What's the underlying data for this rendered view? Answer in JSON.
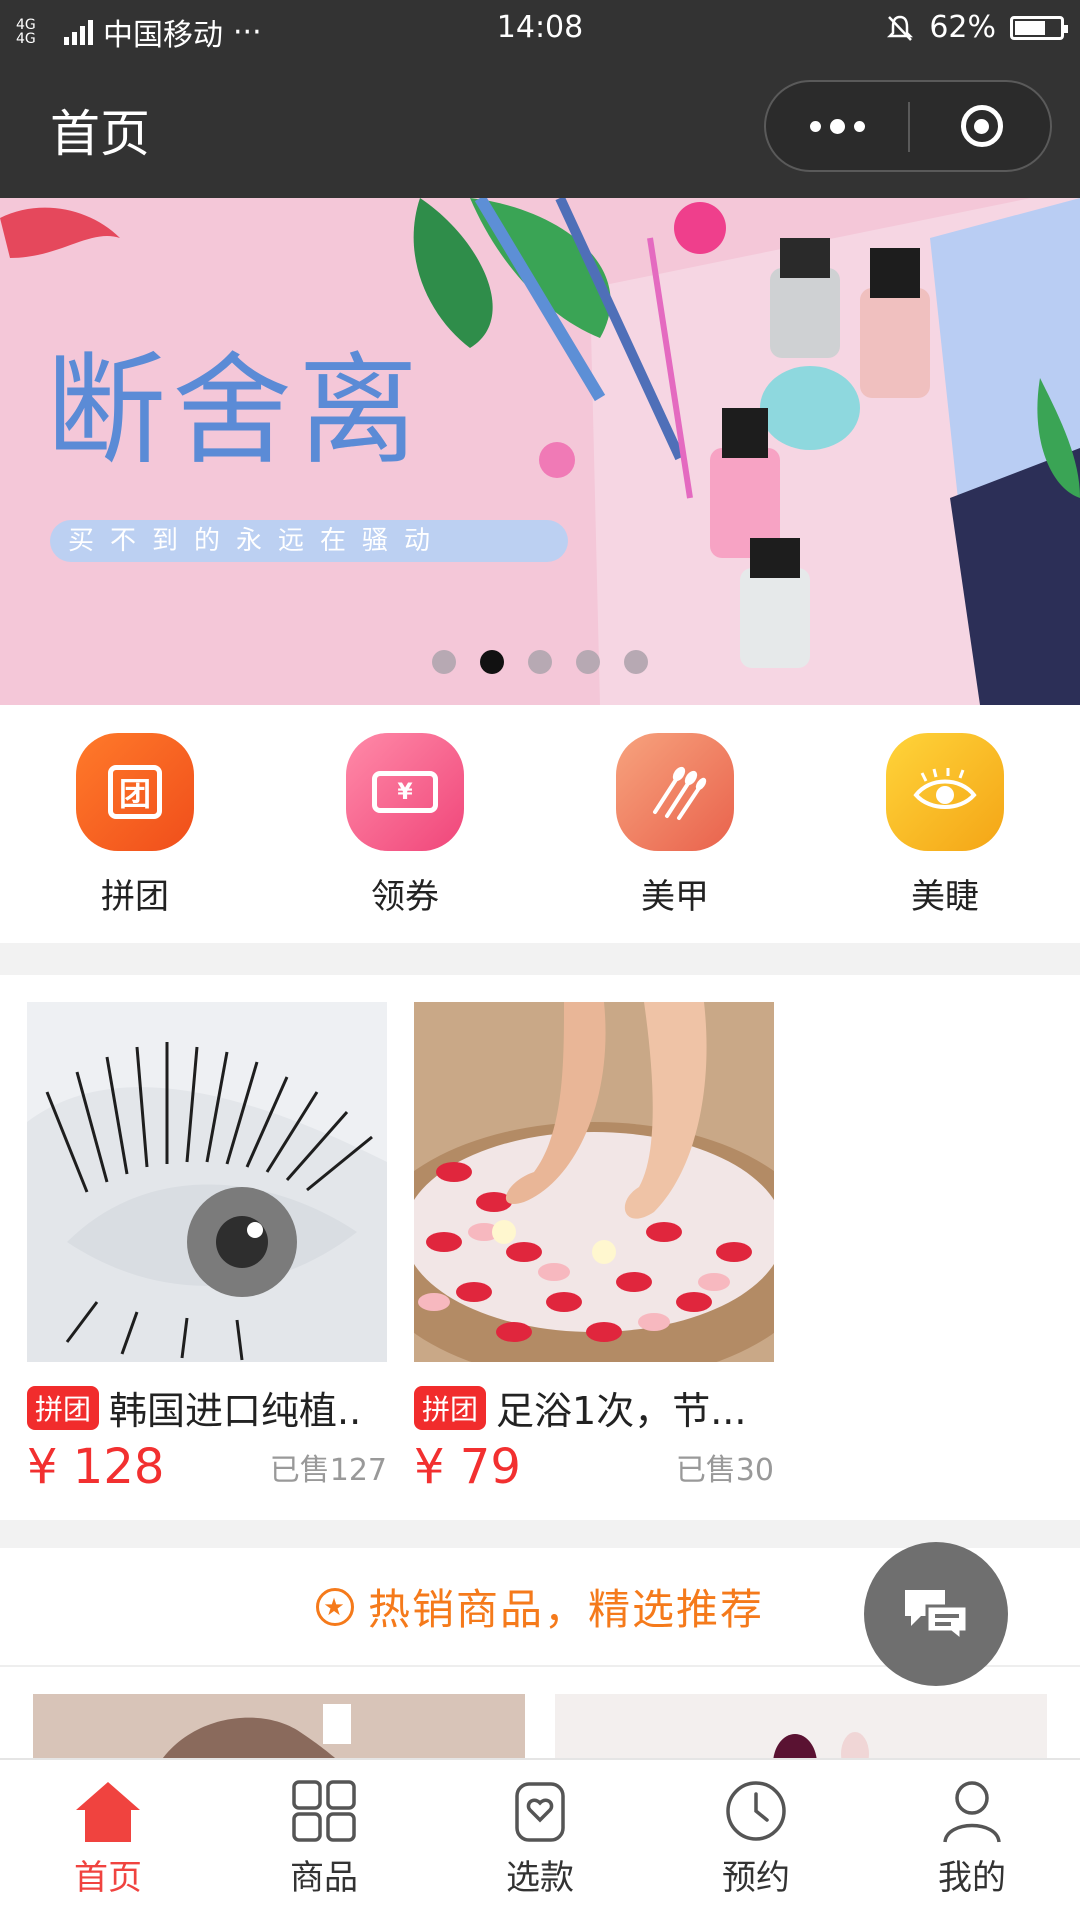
{
  "status_bar": {
    "network": "4G 4G",
    "carrier": "中国移动",
    "more": "···",
    "time": "14:08",
    "battery": "62%",
    "battery_level": 0.62
  },
  "nav": {
    "title": "首页"
  },
  "banner": {
    "title": "断舍离",
    "subtitle": "买不到的永远在骚动",
    "slide_count": 5,
    "active_index": 1
  },
  "categories": [
    {
      "label": "拼团",
      "icon": "group-icon",
      "glyph": "团",
      "color_a": "#ff7a2a",
      "color_b": "#f04e1b"
    },
    {
      "label": "领券",
      "icon": "coupon-icon",
      "glyph": "¥",
      "color_a": "#ff8aa8",
      "color_b": "#f0467a"
    },
    {
      "label": "美甲",
      "icon": "nail-icon",
      "glyph": "",
      "color_a": "#f7a37e",
      "color_b": "#e9624c"
    },
    {
      "label": "美睫",
      "icon": "eyelash-icon",
      "glyph": "",
      "color_a": "#ffd43a",
      "color_b": "#f4a516"
    }
  ],
  "group_buy": [
    {
      "tag": "拼团",
      "name": "韩国进口纯植..",
      "price": "¥ 128",
      "sold": "已售127"
    },
    {
      "tag": "拼团",
      "name": "足浴1次，节...",
      "price": "¥ 79",
      "sold": "已售30"
    }
  ],
  "hot": {
    "title": "热销商品，精选推荐"
  },
  "tabs": [
    {
      "label": "首页",
      "icon": "home-icon",
      "active": true
    },
    {
      "label": "商品",
      "icon": "grid-icon",
      "active": false
    },
    {
      "label": "选款",
      "icon": "heart-bag-icon",
      "active": false
    },
    {
      "label": "预约",
      "icon": "clock-icon",
      "active": false
    },
    {
      "label": "我的",
      "icon": "user-icon",
      "active": false
    }
  ],
  "colors": {
    "accent": "#f23030",
    "hot": "#f57a1b",
    "nav_bg": "#333333"
  }
}
